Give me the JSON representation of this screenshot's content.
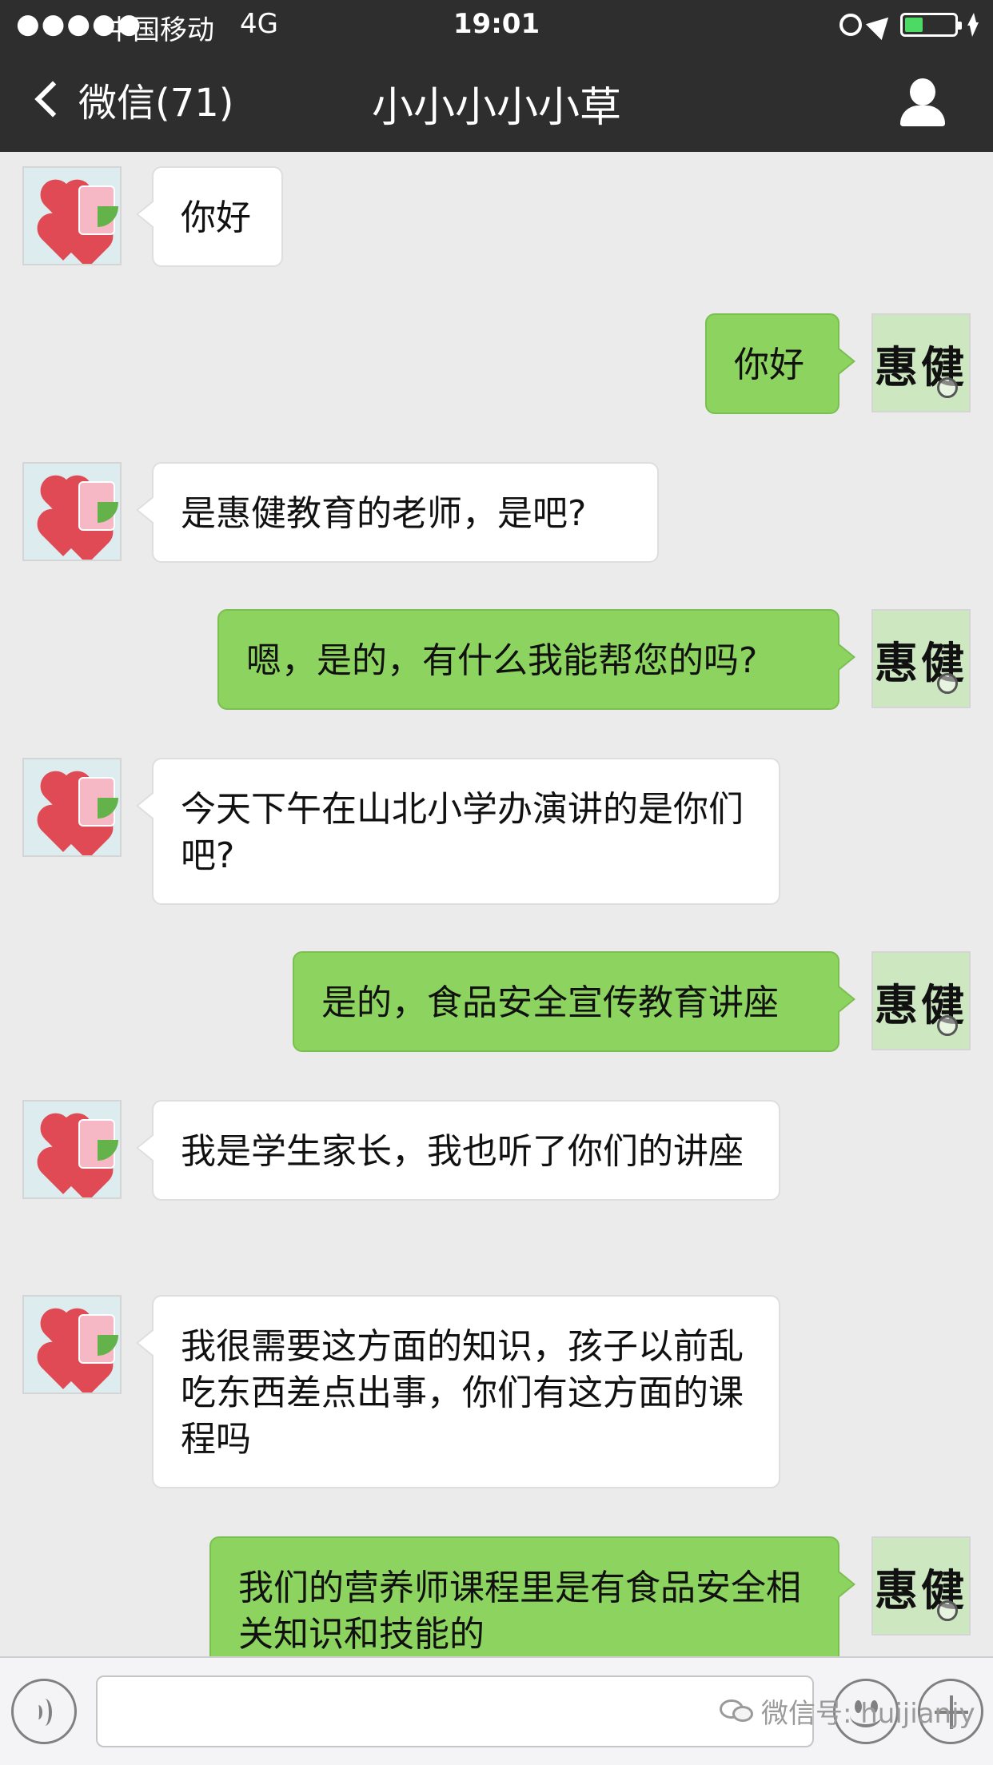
{
  "status_bar": {
    "signal": "●●●●●",
    "carrier": "中国移动",
    "network": "4G",
    "time": "19:01"
  },
  "nav": {
    "back_label": "微信(71)",
    "title": "小小小小小草"
  },
  "messages": [
    {
      "side": "left",
      "text": "你好"
    },
    {
      "side": "right",
      "text": "你好"
    },
    {
      "side": "left",
      "text": "是惠健教育的老师，是吧?"
    },
    {
      "side": "right",
      "text": "嗯，是的，有什么我能帮您的吗?"
    },
    {
      "side": "left",
      "text": "今天下午在山北小学办演讲的是你们吧?"
    },
    {
      "side": "right",
      "text": "是的，食品安全宣传教育讲座"
    },
    {
      "side": "left",
      "text": "我是学生家长，我也听了你们的讲座"
    },
    {
      "side": "left",
      "text": "我很需要这方面的知识，孩子以前乱吃东西差点出事，你们有这方面的课程吗"
    },
    {
      "side": "right",
      "text": "我们的营养师课程里是有食品安全相关知识和技能的"
    }
  ],
  "right_avatar_text": "惠健",
  "input": {
    "value": "",
    "watermark": "微信号: huijianjy"
  },
  "colors": {
    "header_bg": "#2e2e2e",
    "chat_bg": "#ebebeb",
    "right_bubble": "#8cd45f",
    "left_bubble": "#ffffff"
  }
}
